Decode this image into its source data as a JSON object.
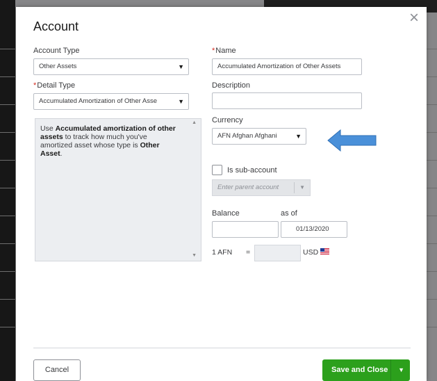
{
  "dialog": {
    "title": "Account",
    "close_glyph": "×",
    "account_type": {
      "label": "Account Type",
      "value": "Other Assets"
    },
    "detail_type": {
      "required": "*",
      "label": "Detail Type",
      "value": "Accumulated Amortization of Other Asse"
    },
    "name": {
      "required": "*",
      "label": "Name",
      "value": "Accumulated Amortization of Other Assets"
    },
    "description": {
      "label": "Description",
      "value": ""
    },
    "currency": {
      "label": "Currency",
      "value": "AFN Afghan Afghani"
    },
    "help": {
      "p1": "Use ",
      "b1": "Accumulated amortization of other assets",
      "p2": " to track how much you've amortized asset whose type is ",
      "b2": "Other Asset",
      "p3": "."
    },
    "sub_account": {
      "label": "Is sub-account",
      "checked": false,
      "parent_placeholder": "Enter parent account"
    },
    "balance": {
      "label": "Balance",
      "value": ""
    },
    "as_of": {
      "label": "as of",
      "value": "01/13/2020"
    },
    "exchange": {
      "from": "1 AFN",
      "eq": "=",
      "rate": "",
      "to": "USD"
    },
    "cancel_label": "Cancel",
    "save_label": "Save and Close",
    "caret_glyph": "▼"
  },
  "annotation": {
    "color": "#4a90d9"
  },
  "colors": {
    "primary_green": "#2ca01c",
    "required_red": "#d52b1e"
  }
}
